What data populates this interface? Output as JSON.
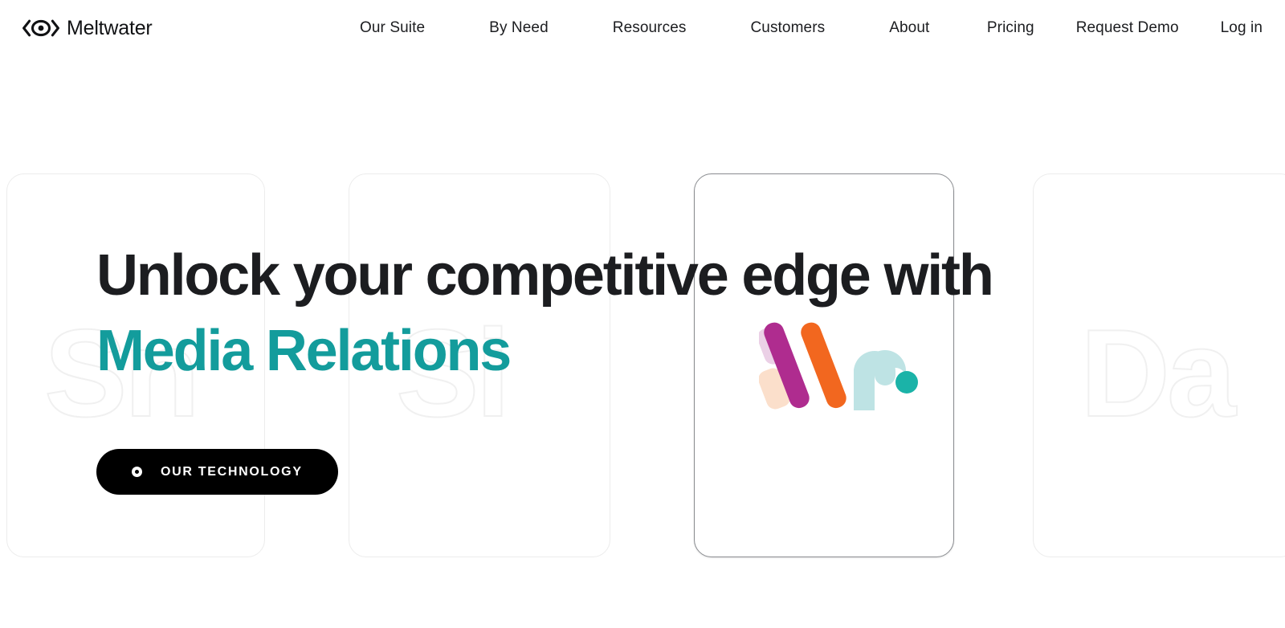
{
  "brand": {
    "name": "Meltwater",
    "logo_icon": "meltwater-eye-logo"
  },
  "nav": {
    "primary": [
      {
        "label": "Our Suite"
      },
      {
        "label": "By Need"
      },
      {
        "label": "Resources"
      },
      {
        "label": "Customers"
      },
      {
        "label": "About"
      }
    ],
    "secondary": [
      {
        "label": "Pricing"
      },
      {
        "label": "Request Demo"
      },
      {
        "label": "Log in"
      }
    ]
  },
  "hero": {
    "headline_line1": "Unlock your competitive edge with",
    "headline_line2": "Media Relations",
    "accent_color": "#139C9C",
    "cta": {
      "label": "OUR TECHNOLOGY",
      "icon": "dot-ring-icon",
      "background_color": "#000000",
      "text_color": "#FFFFFF"
    }
  },
  "carousel": {
    "cards": [
      {
        "id": "card-1",
        "ghost_text": "Sn",
        "active": false
      },
      {
        "id": "card-2",
        "ghost_text": "Si",
        "active": false
      },
      {
        "id": "card-3",
        "ghost_text": "",
        "active": true,
        "graphic": "meltwater-colored-mark"
      },
      {
        "id": "card-4",
        "ghost_text": "Da",
        "active": false
      }
    ],
    "active_border_color": "#8A8C90",
    "inactive_border_color": "#ECECEC"
  },
  "mark_colors": {
    "magenta": "#AF2C8F",
    "orange": "#F2671F",
    "light_pink": "#EBD0E6",
    "light_peach": "#FBDFCB",
    "light_blue": "#BEE3E4",
    "teal_dot": "#1BB3A8"
  }
}
